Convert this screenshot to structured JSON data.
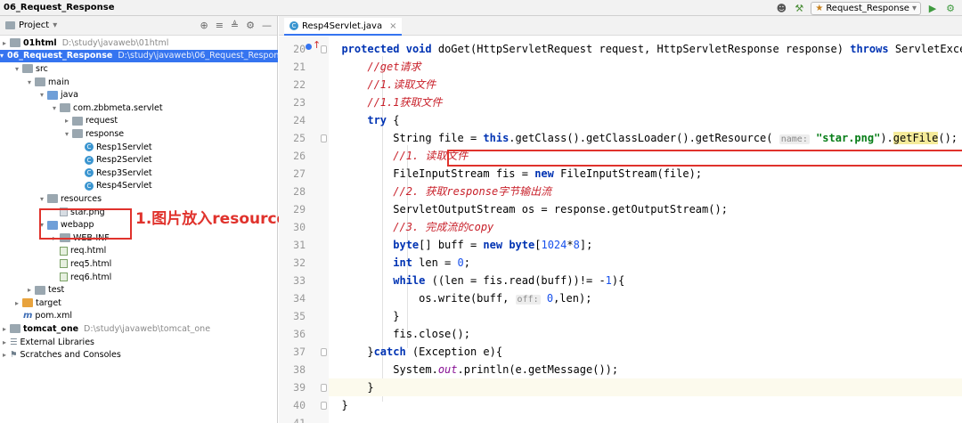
{
  "titlebar": {
    "project_name": "06_Request_Response",
    "run_config": "Request_Response"
  },
  "project_panel": {
    "title": "Project",
    "tree": [
      {
        "label": "01html",
        "path": "D:\\study\\javaweb\\01html",
        "bold": true
      },
      {
        "label": "06_Request_Response",
        "path": "D:\\study\\javaweb\\06_Request_Response",
        "bold": true,
        "selected": true
      },
      {
        "label": "src"
      },
      {
        "label": "main"
      },
      {
        "label": "java"
      },
      {
        "label": "com.zbbmeta.servlet"
      },
      {
        "label": "request"
      },
      {
        "label": "response"
      },
      {
        "label": "Resp1Servlet"
      },
      {
        "label": "Resp2Servlet"
      },
      {
        "label": "Resp3Servlet"
      },
      {
        "label": "Resp4Servlet"
      },
      {
        "label": "resources"
      },
      {
        "label": "star.png"
      },
      {
        "label": "webapp"
      },
      {
        "label": "WEB-INF"
      },
      {
        "label": "req.html"
      },
      {
        "label": "req5.html"
      },
      {
        "label": "req6.html"
      },
      {
        "label": "test"
      },
      {
        "label": "target"
      },
      {
        "label": "pom.xml"
      },
      {
        "label": "tomcat_one",
        "path": "D:\\study\\javaweb\\tomcat_one",
        "bold": true
      },
      {
        "label": "External Libraries"
      },
      {
        "label": "Scratches and Consoles"
      }
    ],
    "annotation": "1.图片放入resources目录"
  },
  "editor": {
    "tab_label": "Resp4Servlet.java",
    "line_numbers": [
      "20",
      "21",
      "22",
      "23",
      "24",
      "25",
      "26",
      "27",
      "28",
      "29",
      "30",
      "31",
      "32",
      "33",
      "34",
      "35",
      "36",
      "37",
      "38",
      "39",
      "40",
      "41"
    ]
  },
  "colors": {
    "selection": "#3574f0",
    "annotation": "#e0322c",
    "keyword": "#0033b3",
    "comment": "#c8202a",
    "string": "#067d17"
  }
}
